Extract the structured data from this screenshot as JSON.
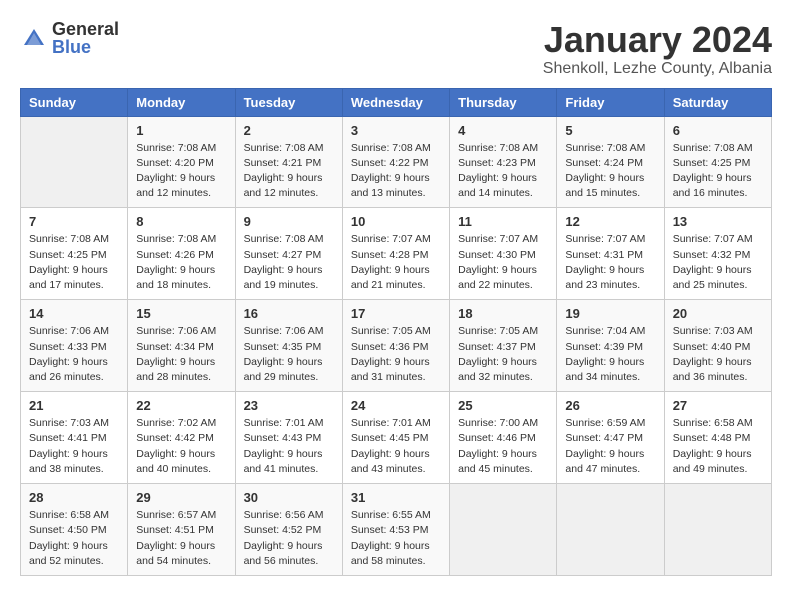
{
  "header": {
    "logo_general": "General",
    "logo_blue": "Blue",
    "month_title": "January 2024",
    "location": "Shenkoll, Lezhe County, Albania"
  },
  "days_of_week": [
    "Sunday",
    "Monday",
    "Tuesday",
    "Wednesday",
    "Thursday",
    "Friday",
    "Saturday"
  ],
  "weeks": [
    [
      {
        "day": "",
        "sunrise": "",
        "sunset": "",
        "daylight": ""
      },
      {
        "day": "1",
        "sunrise": "Sunrise: 7:08 AM",
        "sunset": "Sunset: 4:20 PM",
        "daylight": "Daylight: 9 hours and 12 minutes."
      },
      {
        "day": "2",
        "sunrise": "Sunrise: 7:08 AM",
        "sunset": "Sunset: 4:21 PM",
        "daylight": "Daylight: 9 hours and 12 minutes."
      },
      {
        "day": "3",
        "sunrise": "Sunrise: 7:08 AM",
        "sunset": "Sunset: 4:22 PM",
        "daylight": "Daylight: 9 hours and 13 minutes."
      },
      {
        "day": "4",
        "sunrise": "Sunrise: 7:08 AM",
        "sunset": "Sunset: 4:23 PM",
        "daylight": "Daylight: 9 hours and 14 minutes."
      },
      {
        "day": "5",
        "sunrise": "Sunrise: 7:08 AM",
        "sunset": "Sunset: 4:24 PM",
        "daylight": "Daylight: 9 hours and 15 minutes."
      },
      {
        "day": "6",
        "sunrise": "Sunrise: 7:08 AM",
        "sunset": "Sunset: 4:25 PM",
        "daylight": "Daylight: 9 hours and 16 minutes."
      }
    ],
    [
      {
        "day": "7",
        "sunrise": "Sunrise: 7:08 AM",
        "sunset": "Sunset: 4:25 PM",
        "daylight": "Daylight: 9 hours and 17 minutes."
      },
      {
        "day": "8",
        "sunrise": "Sunrise: 7:08 AM",
        "sunset": "Sunset: 4:26 PM",
        "daylight": "Daylight: 9 hours and 18 minutes."
      },
      {
        "day": "9",
        "sunrise": "Sunrise: 7:08 AM",
        "sunset": "Sunset: 4:27 PM",
        "daylight": "Daylight: 9 hours and 19 minutes."
      },
      {
        "day": "10",
        "sunrise": "Sunrise: 7:07 AM",
        "sunset": "Sunset: 4:28 PM",
        "daylight": "Daylight: 9 hours and 21 minutes."
      },
      {
        "day": "11",
        "sunrise": "Sunrise: 7:07 AM",
        "sunset": "Sunset: 4:30 PM",
        "daylight": "Daylight: 9 hours and 22 minutes."
      },
      {
        "day": "12",
        "sunrise": "Sunrise: 7:07 AM",
        "sunset": "Sunset: 4:31 PM",
        "daylight": "Daylight: 9 hours and 23 minutes."
      },
      {
        "day": "13",
        "sunrise": "Sunrise: 7:07 AM",
        "sunset": "Sunset: 4:32 PM",
        "daylight": "Daylight: 9 hours and 25 minutes."
      }
    ],
    [
      {
        "day": "14",
        "sunrise": "Sunrise: 7:06 AM",
        "sunset": "Sunset: 4:33 PM",
        "daylight": "Daylight: 9 hours and 26 minutes."
      },
      {
        "day": "15",
        "sunrise": "Sunrise: 7:06 AM",
        "sunset": "Sunset: 4:34 PM",
        "daylight": "Daylight: 9 hours and 28 minutes."
      },
      {
        "day": "16",
        "sunrise": "Sunrise: 7:06 AM",
        "sunset": "Sunset: 4:35 PM",
        "daylight": "Daylight: 9 hours and 29 minutes."
      },
      {
        "day": "17",
        "sunrise": "Sunrise: 7:05 AM",
        "sunset": "Sunset: 4:36 PM",
        "daylight": "Daylight: 9 hours and 31 minutes."
      },
      {
        "day": "18",
        "sunrise": "Sunrise: 7:05 AM",
        "sunset": "Sunset: 4:37 PM",
        "daylight": "Daylight: 9 hours and 32 minutes."
      },
      {
        "day": "19",
        "sunrise": "Sunrise: 7:04 AM",
        "sunset": "Sunset: 4:39 PM",
        "daylight": "Daylight: 9 hours and 34 minutes."
      },
      {
        "day": "20",
        "sunrise": "Sunrise: 7:03 AM",
        "sunset": "Sunset: 4:40 PM",
        "daylight": "Daylight: 9 hours and 36 minutes."
      }
    ],
    [
      {
        "day": "21",
        "sunrise": "Sunrise: 7:03 AM",
        "sunset": "Sunset: 4:41 PM",
        "daylight": "Daylight: 9 hours and 38 minutes."
      },
      {
        "day": "22",
        "sunrise": "Sunrise: 7:02 AM",
        "sunset": "Sunset: 4:42 PM",
        "daylight": "Daylight: 9 hours and 40 minutes."
      },
      {
        "day": "23",
        "sunrise": "Sunrise: 7:01 AM",
        "sunset": "Sunset: 4:43 PM",
        "daylight": "Daylight: 9 hours and 41 minutes."
      },
      {
        "day": "24",
        "sunrise": "Sunrise: 7:01 AM",
        "sunset": "Sunset: 4:45 PM",
        "daylight": "Daylight: 9 hours and 43 minutes."
      },
      {
        "day": "25",
        "sunrise": "Sunrise: 7:00 AM",
        "sunset": "Sunset: 4:46 PM",
        "daylight": "Daylight: 9 hours and 45 minutes."
      },
      {
        "day": "26",
        "sunrise": "Sunrise: 6:59 AM",
        "sunset": "Sunset: 4:47 PM",
        "daylight": "Daylight: 9 hours and 47 minutes."
      },
      {
        "day": "27",
        "sunrise": "Sunrise: 6:58 AM",
        "sunset": "Sunset: 4:48 PM",
        "daylight": "Daylight: 9 hours and 49 minutes."
      }
    ],
    [
      {
        "day": "28",
        "sunrise": "Sunrise: 6:58 AM",
        "sunset": "Sunset: 4:50 PM",
        "daylight": "Daylight: 9 hours and 52 minutes."
      },
      {
        "day": "29",
        "sunrise": "Sunrise: 6:57 AM",
        "sunset": "Sunset: 4:51 PM",
        "daylight": "Daylight: 9 hours and 54 minutes."
      },
      {
        "day": "30",
        "sunrise": "Sunrise: 6:56 AM",
        "sunset": "Sunset: 4:52 PM",
        "daylight": "Daylight: 9 hours and 56 minutes."
      },
      {
        "day": "31",
        "sunrise": "Sunrise: 6:55 AM",
        "sunset": "Sunset: 4:53 PM",
        "daylight": "Daylight: 9 hours and 58 minutes."
      },
      {
        "day": "",
        "sunrise": "",
        "sunset": "",
        "daylight": ""
      },
      {
        "day": "",
        "sunrise": "",
        "sunset": "",
        "daylight": ""
      },
      {
        "day": "",
        "sunrise": "",
        "sunset": "",
        "daylight": ""
      }
    ]
  ]
}
